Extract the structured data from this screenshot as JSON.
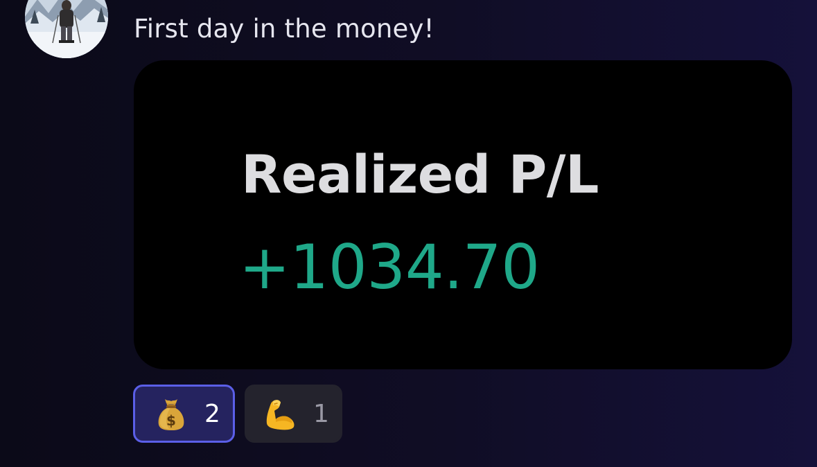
{
  "message": {
    "text": "First day in the money!",
    "avatar_icon": "user-avatar-photo"
  },
  "attachment": {
    "title": "Realized P/L",
    "value": "+1034.70",
    "value_color": "#1fa889",
    "background": "#000000"
  },
  "reactions": [
    {
      "emoji_name": "money-bag-icon",
      "count": "2",
      "selected": true
    },
    {
      "emoji_name": "flexed-biceps-icon",
      "count": "1",
      "selected": false
    }
  ],
  "colors": {
    "accent": "#5b5fe8",
    "selected_reaction_bg": "#25235f",
    "reaction_bg": "#24232d",
    "page_bg": "#100d25"
  }
}
